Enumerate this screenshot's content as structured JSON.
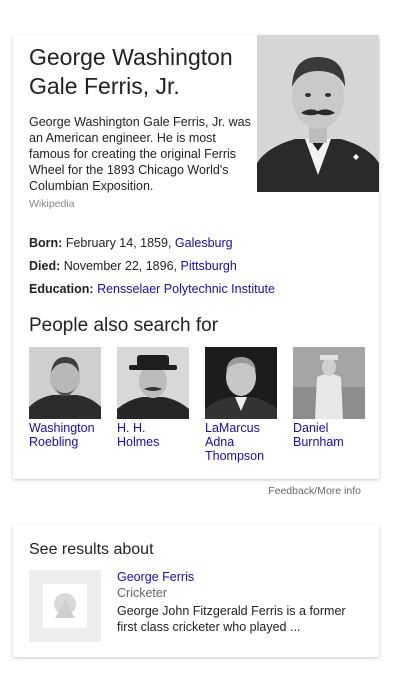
{
  "knowledge_panel": {
    "title": "George Washington Gale Ferris, Jr.",
    "portrait_icon": "person-portrait-icon",
    "description": "George Washington Gale Ferris, Jr. was an American engineer. He is most famous for creating the original Ferris Wheel for the 1893 Chicago World's Columbian Exposition.",
    "source": "Wikipedia",
    "facts": [
      {
        "label": "Born:",
        "text": "February 14, 1859, ",
        "link": "Galesburg"
      },
      {
        "label": "Died:",
        "text": "November 22, 1896, ",
        "link": "Pittsburgh"
      },
      {
        "label": "Education:",
        "text": "",
        "link": "Rensselaer Polytechnic Institute"
      }
    ],
    "people_heading": "People also search for",
    "people": [
      {
        "name": "Washington Roebling"
      },
      {
        "name": "H. H. Holmes"
      },
      {
        "name": "LaMarcus Adna Thompson"
      },
      {
        "name": "Daniel Burnham"
      }
    ]
  },
  "feedback": "Feedback/More info",
  "results": {
    "heading": "See results about",
    "item": {
      "title": "George Ferris",
      "subtitle": "Cricketer",
      "description": "George John Fitzgerald Ferris is a former first class cricketer who played ...",
      "thumb_icon": "shapes-placeholder-icon"
    }
  },
  "colors": {
    "link": "#1a0dab",
    "text": "#222222",
    "muted": "#888888"
  }
}
